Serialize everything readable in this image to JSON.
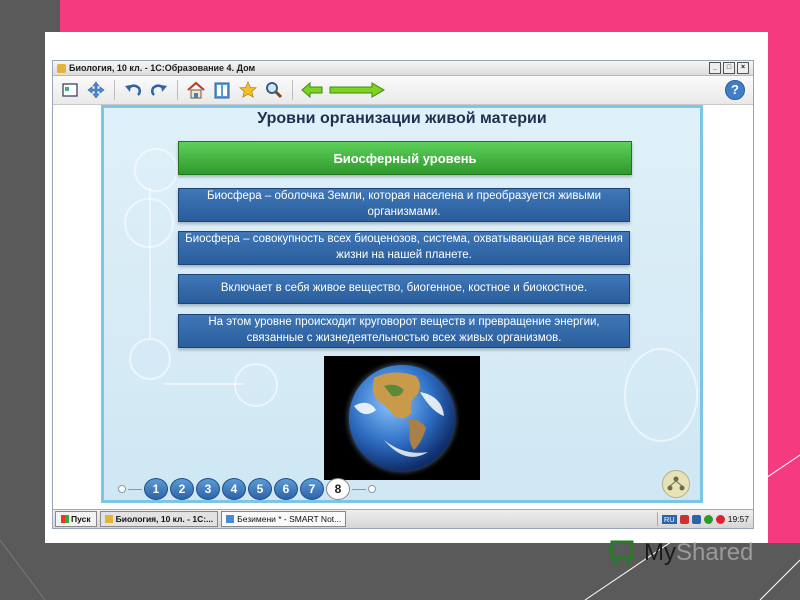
{
  "window": {
    "title": "Биология, 10 кл. - 1С:Образование 4. Дом",
    "buttons": {
      "minimize": "_",
      "maximize": "□",
      "close": "×"
    }
  },
  "toolbar": {
    "icons": [
      "fullscreen-icon",
      "move-icon",
      "undo-icon",
      "redo-icon",
      "home-icon",
      "book-icon",
      "star-icon",
      "search-icon",
      "back-arrow-icon",
      "forward-arrow-icon"
    ],
    "help_label": "?"
  },
  "slide": {
    "heading": "Уровни организации живой материи",
    "level_title": "Биосферный уровень",
    "statements": [
      "Биосфера – оболочка Земли, которая населена и преобразуется живыми организмами.",
      "Биосфера – совокупность всех биоценозов, система, охватывающая все явления жизни на нашей планете.",
      "Включает в себя живое вещество, биогенное, костное и биокостное.",
      "На этом уровне происходит круговорот веществ и превращение энергии, связанные с жизнедеятельностью всех живых организмов."
    ]
  },
  "pager": {
    "pages": [
      "1",
      "2",
      "3",
      "4",
      "5",
      "6",
      "7",
      "8"
    ],
    "current": "8"
  },
  "taskbar": {
    "start_label": "Пуск",
    "tasks": [
      "Биология, 10 кл. - 1С:...",
      "Безимени * - SMART Not..."
    ],
    "lang": "RU",
    "clock": "19:57"
  },
  "watermark": {
    "text_dark": "My",
    "text_light": "Shared"
  },
  "colors": {
    "frame_pink": "#f53b7f",
    "frame_grey": "#5a5a5a",
    "green_bar": "#2f9a2c",
    "blue_box": "#2a5d9b",
    "content_bg": "#dff0f8"
  }
}
